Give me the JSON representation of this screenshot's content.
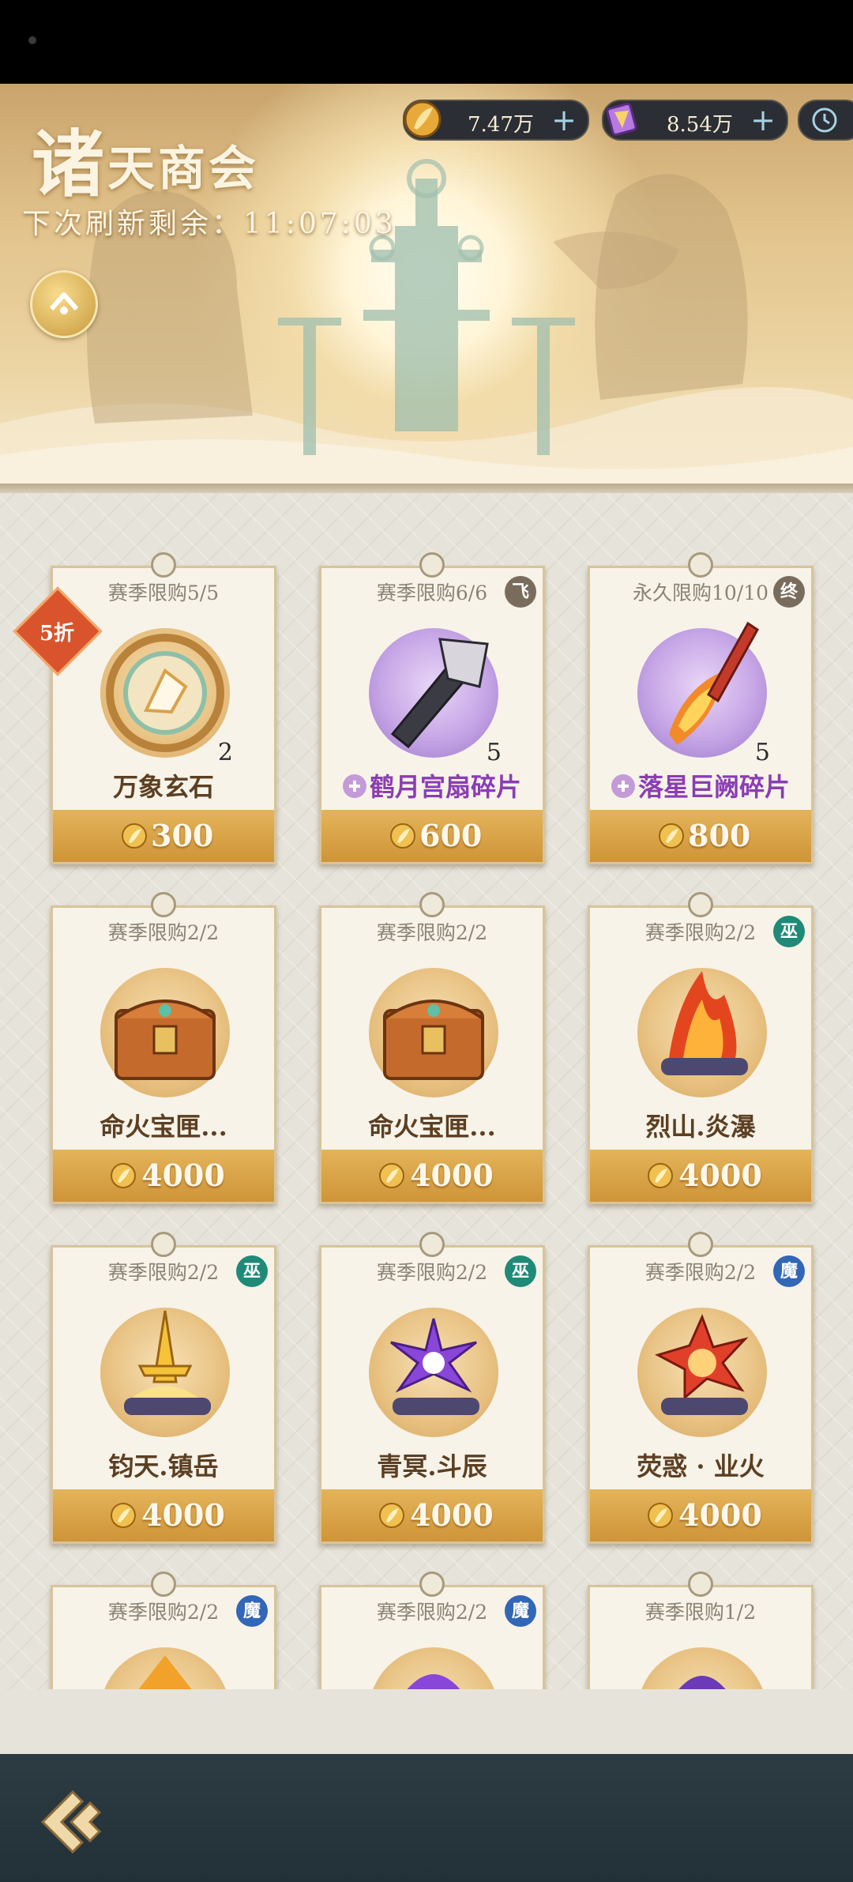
{
  "header": {
    "title_first": "诸",
    "title_rest": "天商会",
    "refresh_label": "下次刷新剩余：11:07:03"
  },
  "currencies": [
    {
      "value": "7.47万",
      "plus": "+"
    },
    {
      "value": "8.54万",
      "plus": "+"
    }
  ],
  "cards": [
    {
      "limit": "赛季限购5/5",
      "name": "万象玄石",
      "qty": "2",
      "price": "300",
      "discount": "5折"
    },
    {
      "limit": "赛季限购6/6",
      "name": "鹤月宫扇碎片",
      "qty": "5",
      "price": "600",
      "badge": "飞"
    },
    {
      "limit": "永久限购10/10",
      "name": "落星巨阙碎片",
      "qty": "5",
      "price": "800",
      "badge": "终"
    },
    {
      "limit": "赛季限购2/2",
      "name": "命火宝匣...",
      "price": "4000"
    },
    {
      "limit": "赛季限购2/2",
      "name": "命火宝匣...",
      "price": "4000"
    },
    {
      "limit": "赛季限购2/2",
      "name": "烈山.炎瀑",
      "price": "4000",
      "badge": "巫"
    },
    {
      "limit": "赛季限购2/2",
      "name": "钧天.镇岳",
      "price": "4000",
      "badge": "巫"
    },
    {
      "limit": "赛季限购2/2",
      "name": "青冥.斗辰",
      "price": "4000",
      "badge": "巫"
    },
    {
      "limit": "赛季限购2/2",
      "name": "荧惑 · 业火",
      "price": "4000",
      "badge": "魔"
    },
    {
      "limit": "赛季限购2/2",
      "badge": "魔"
    },
    {
      "limit": "赛季限购2/2",
      "badge": "魔"
    },
    {
      "limit": "赛季限购1/2"
    }
  ],
  "colors": {
    "price_bar": "#d9a247",
    "name_text": "#5c3f22",
    "fragment_text": "#8a3db4",
    "badge_wu": "#1f8a78",
    "badge_mo": "#3266b6",
    "discount": "#d9542c"
  },
  "icons": {
    "currency_1": "gold-feather-coin-icon",
    "currency_2": "purple-gem-icon",
    "clock": "clock-icon",
    "up": "chevron-up-icon",
    "back": "back-arrow-icon"
  }
}
